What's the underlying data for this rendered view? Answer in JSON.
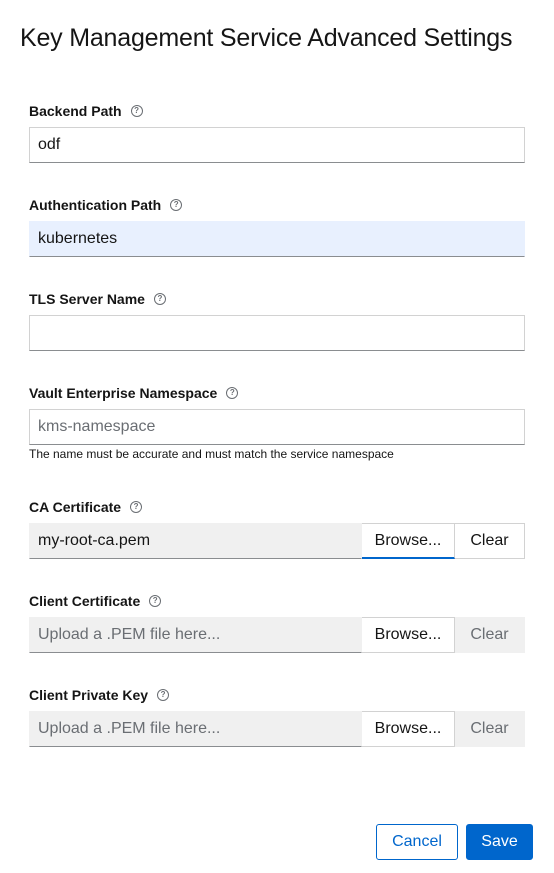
{
  "title": "Key Management Service Advanced Settings",
  "backend_path": {
    "label": "Backend Path",
    "value": "odf",
    "help_icon": "question-circle-icon"
  },
  "auth_path": {
    "label": "Authentication Path",
    "value": "kubernetes",
    "help_icon": "question-circle-icon"
  },
  "tls_server": {
    "label": "TLS Server Name",
    "value": "",
    "help_icon": "question-circle-icon"
  },
  "vault_ns": {
    "label": "Vault Enterprise Namespace",
    "placeholder": "kms-namespace",
    "helper": "The name must be accurate and must match the service namespace",
    "help_icon": "question-circle-icon"
  },
  "ca_cert": {
    "label": "CA Certificate",
    "filename": "my-root-ca.pem",
    "browse": "Browse...",
    "clear": "Clear"
  },
  "client_cert": {
    "label": "Client Certificate",
    "placeholder": "Upload a .PEM file here...",
    "browse": "Browse...",
    "clear": "Clear"
  },
  "client_key": {
    "label": "Client Private Key",
    "placeholder": "Upload a .PEM file here...",
    "browse": "Browse...",
    "clear": "Clear"
  },
  "footer": {
    "cancel": "Cancel",
    "save": "Save"
  },
  "colors": {
    "primary": "#0066cc",
    "autofill": "#e8f0fe",
    "disabled": "#f0f0f0"
  }
}
